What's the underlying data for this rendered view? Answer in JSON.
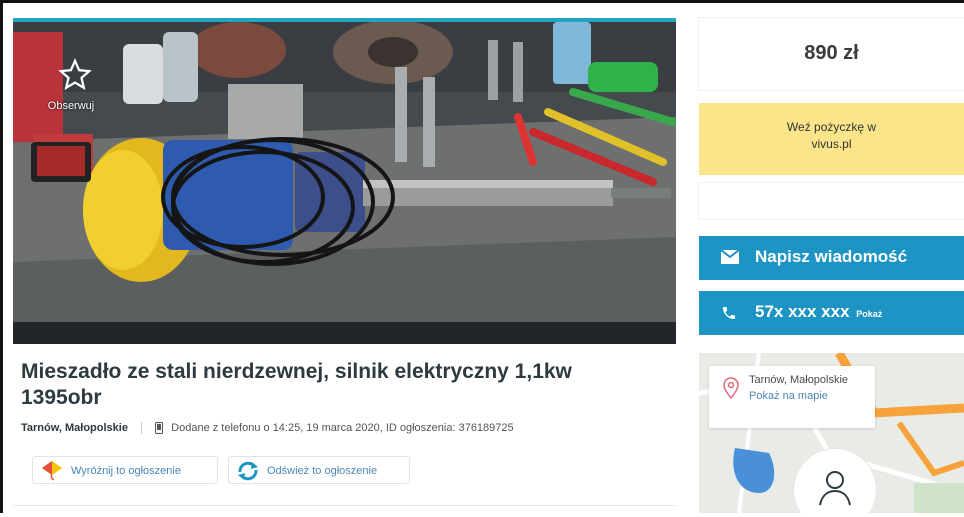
{
  "listing": {
    "watch_label": "Obserwuj",
    "title": "Mieszadło ze stali nierdzewnej, silnik elektryczny 1,1kw 1395obr",
    "location": "Tarnów, Małopolskie",
    "added_text": "Dodane z telefonu",
    "date_text": "o 14:25, 19 marca 2020, ID ogłoszenia: 376189725",
    "feature_button": "Wyróżnij to ogłoszenie",
    "refresh_button": "Odśwież to ogłoszenie"
  },
  "sidebar": {
    "price": "890 zł",
    "loan_line1": "Weź pożyczkę w",
    "loan_line2": "vivus.pl",
    "message_button": "Napisz wiadomość",
    "phone_number": "57x xxx xxx",
    "phone_show": "Pokaż",
    "map_city": "Tarnów, Małopolskie",
    "map_link": "Pokaż na mapie"
  },
  "colors": {
    "accent": "#1e94c5",
    "loan_bg": "#fbe58a",
    "top_bar": "#23a3c2"
  },
  "icons": [
    "star-icon",
    "phone-device-icon",
    "kite-icon",
    "refresh-icon",
    "envelope-icon",
    "phone-icon",
    "map-pin-icon",
    "user-avatar-icon"
  ]
}
